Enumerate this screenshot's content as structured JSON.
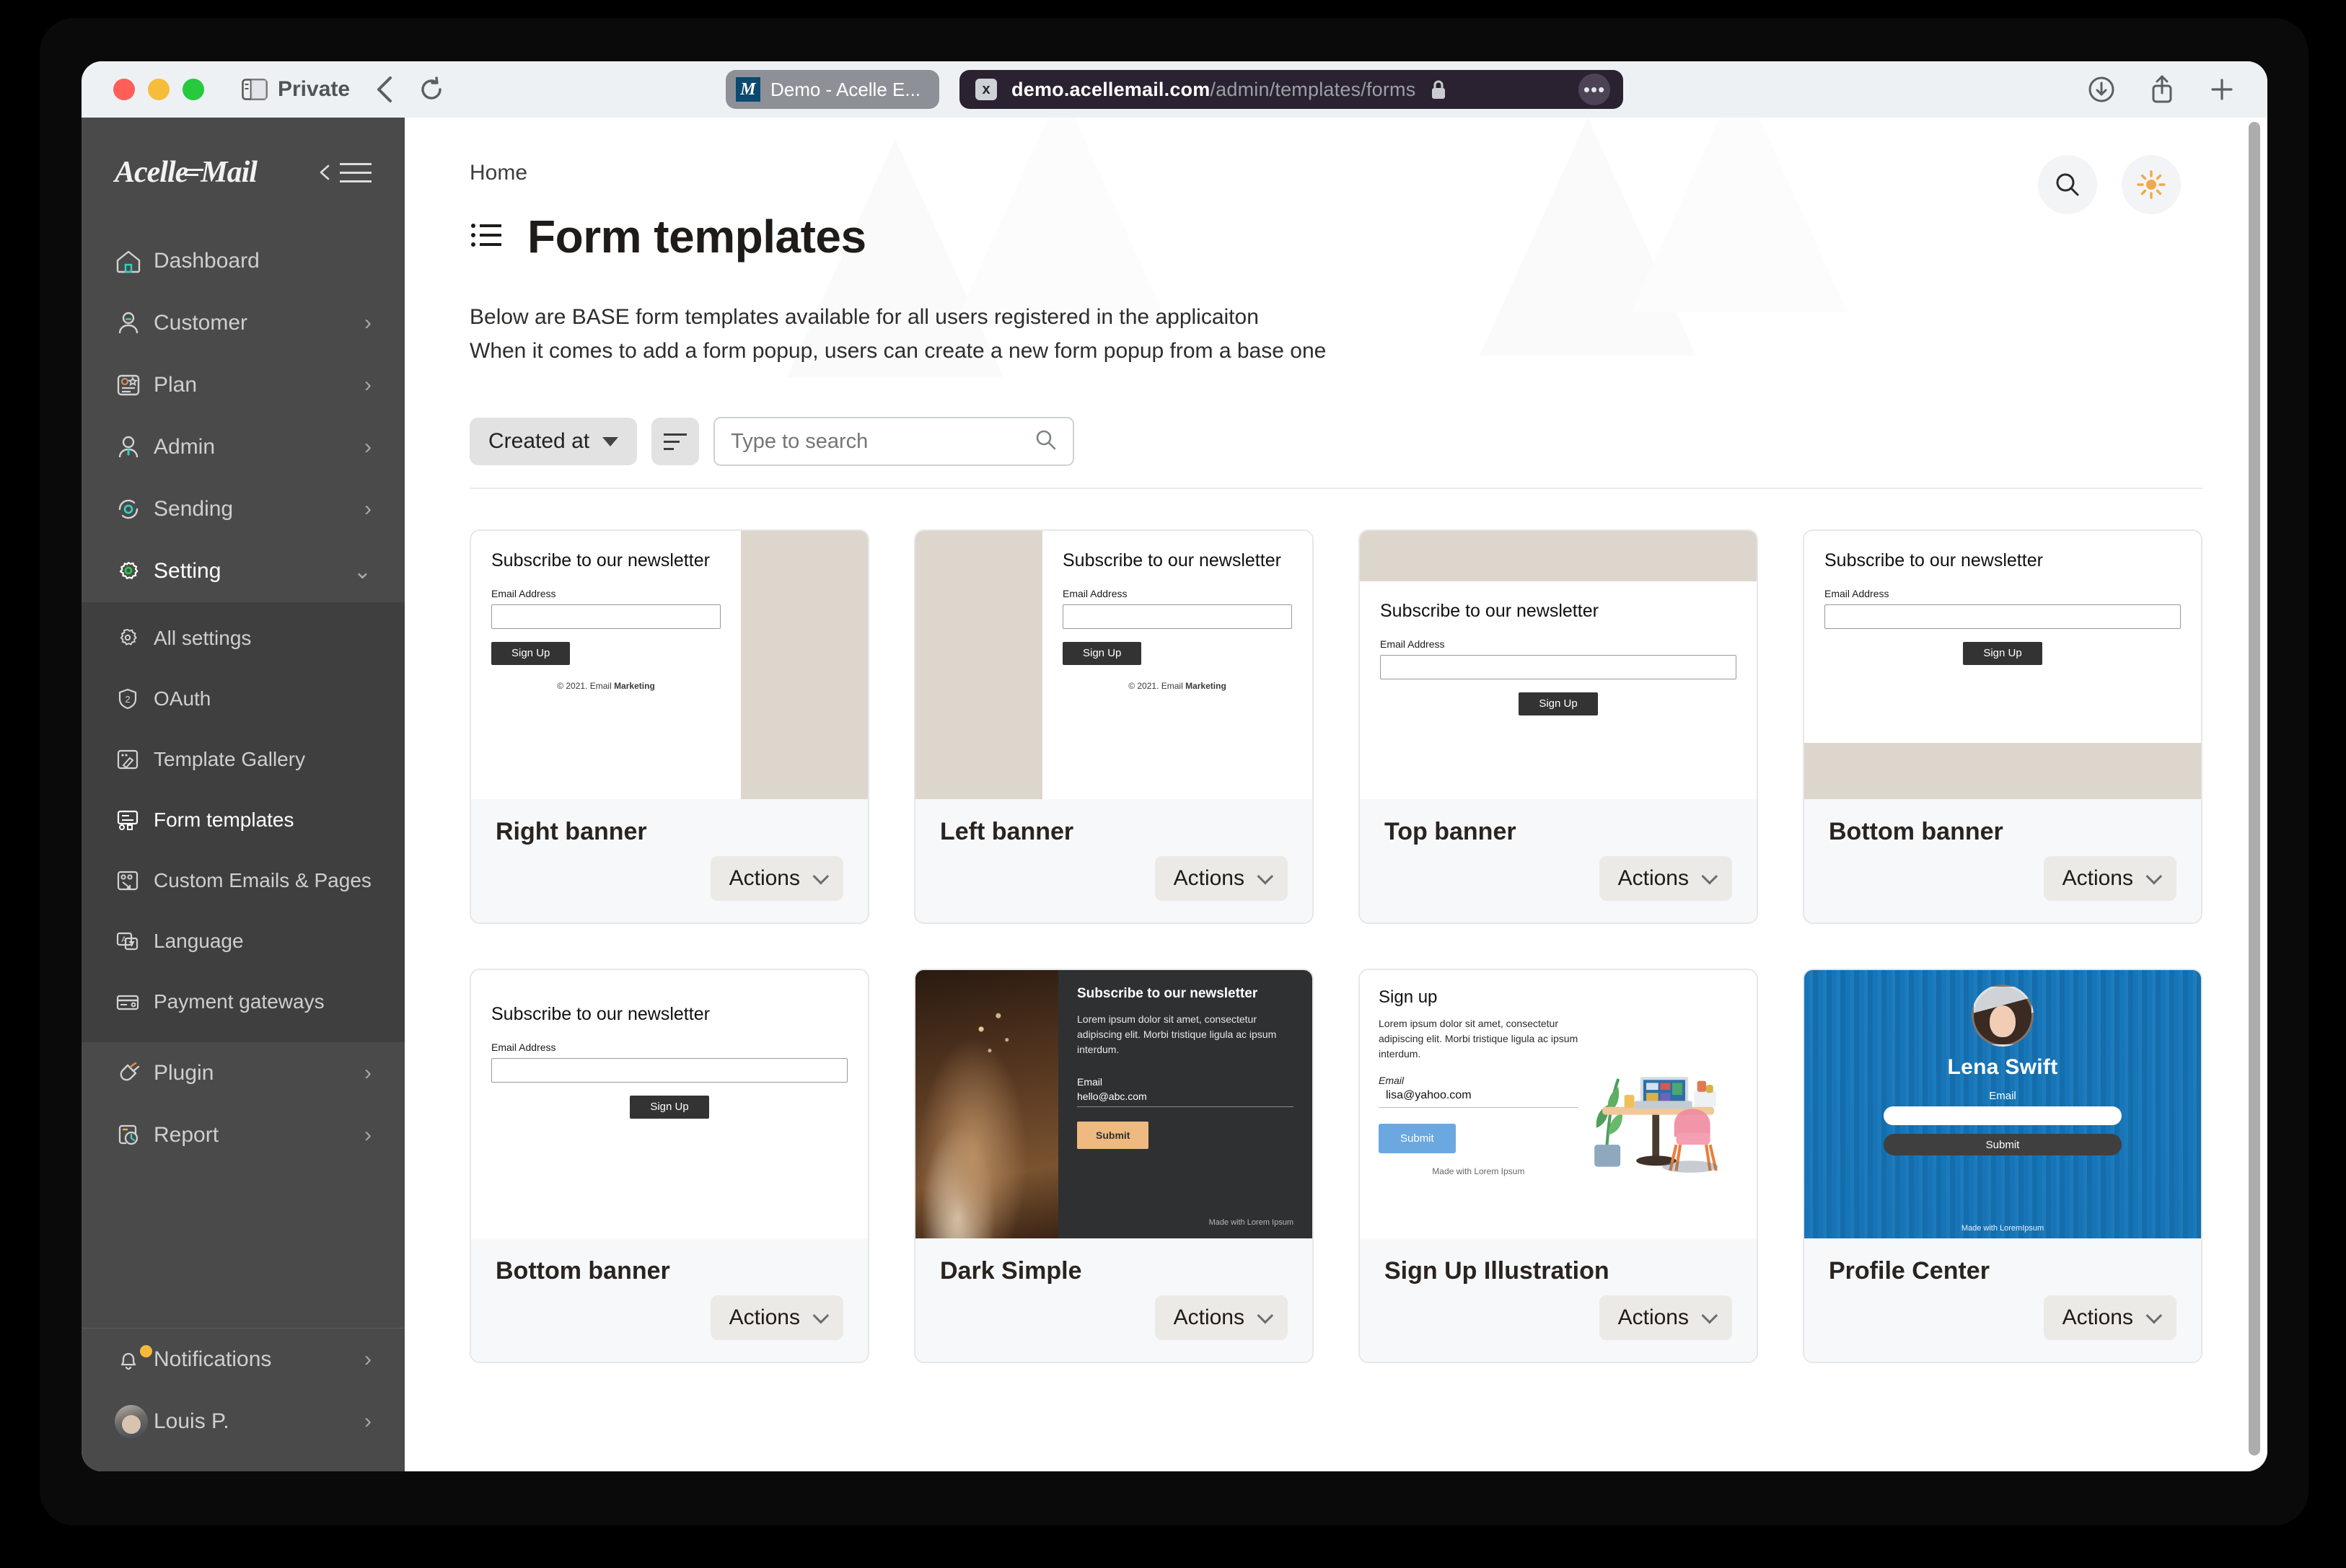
{
  "browser": {
    "private_label": "Private",
    "tab": {
      "favicon_letter": "M",
      "title": "Demo - Acelle E..."
    },
    "url": {
      "domain": "demo.acellemail.com",
      "path": "/admin/templates/forms",
      "close_glyph": "x",
      "menu_glyph": "•••"
    },
    "icons": {
      "sidebar": "sidebar-toggle-icon",
      "back": "back-arrow-icon",
      "reload": "reload-icon",
      "downloads": "downloads-icon",
      "share": "share-icon",
      "newtab": "new-tab-icon",
      "lock": "lock-icon"
    }
  },
  "sidebar": {
    "brand": {
      "left": "Acelle",
      "right": "Mail"
    },
    "items": [
      {
        "label": "Dashboard",
        "icon": "home-icon",
        "chevron": "",
        "active": false
      },
      {
        "label": "Customer",
        "icon": "user-icon",
        "chevron": "›",
        "active": false
      },
      {
        "label": "Plan",
        "icon": "plan-card-icon",
        "chevron": "›",
        "active": false
      },
      {
        "label": "Admin",
        "icon": "admin-user-icon",
        "chevron": "›",
        "active": false
      },
      {
        "label": "Sending",
        "icon": "sending-sync-icon",
        "chevron": "›",
        "active": false
      },
      {
        "label": "Setting",
        "icon": "gear-icon",
        "chevron": "⌄",
        "active": true
      }
    ],
    "submenu": [
      {
        "label": "All settings",
        "icon": "settings-gear-icon",
        "active": false
      },
      {
        "label": "OAuth",
        "icon": "shield-2-icon",
        "active": false
      },
      {
        "label": "Template Gallery",
        "icon": "brush-icon",
        "active": false
      },
      {
        "label": "Form templates",
        "icon": "form-icon",
        "active": true
      },
      {
        "label": "Custom Emails & Pages",
        "icon": "custom-page-icon",
        "active": false
      },
      {
        "label": "Language",
        "icon": "translate-icon",
        "active": false
      },
      {
        "label": "Payment gateways",
        "icon": "credit-card-icon",
        "active": false
      }
    ],
    "items_after": [
      {
        "label": "Plugin",
        "icon": "plug-icon",
        "chevron": "›"
      },
      {
        "label": "Report",
        "icon": "report-clock-icon",
        "chevron": "›"
      }
    ],
    "footer": [
      {
        "label": "Notifications",
        "icon": "bell-icon",
        "chevron": "›",
        "badge": true
      },
      {
        "label": "Louis P.",
        "icon": "avatar",
        "chevron": "›",
        "badge": false
      }
    ]
  },
  "header": {
    "breadcrumb": "Home",
    "title": "Form templates",
    "title_icon": "list-icon",
    "search_icon": "search-icon",
    "theme_icon": "sun-icon",
    "description_line1": "Below are BASE form templates available for all users registered in the applicaiton",
    "description_line2": "When it comes to add a form popup, users can create a new form popup from a base one"
  },
  "toolbar": {
    "sort_field": "Created at",
    "sort_direction_icon": "sort-icon",
    "search_placeholder": "Type to search",
    "search_value": "",
    "search_icon": "search-icon"
  },
  "cards": [
    {
      "name": "Right banner",
      "actions_label": "Actions",
      "layout": "right-banner",
      "title": "Subscribe to our newsletter",
      "field_label": "Email Address",
      "button": "Sign Up",
      "copyright_prefix": "© 2021. Email ",
      "copyright_bold": "Marketing"
    },
    {
      "name": "Left banner",
      "actions_label": "Actions",
      "layout": "left-banner",
      "title": "Subscribe to our newsletter",
      "field_label": "Email Address",
      "button": "Sign Up",
      "copyright_prefix": "© 2021. Email ",
      "copyright_bold": "Marketing"
    },
    {
      "name": "Top banner",
      "actions_label": "Actions",
      "layout": "top-banner",
      "title": "Subscribe to our newsletter",
      "field_label": "Email Address",
      "button": "Sign Up"
    },
    {
      "name": "Bottom banner",
      "actions_label": "Actions",
      "layout": "bottom-banner",
      "title": "Subscribe to our newsletter",
      "field_label": "Email Address",
      "button": "Sign Up"
    },
    {
      "name": "Bottom banner",
      "actions_label": "Actions",
      "layout": "plain",
      "title": "Subscribe to our newsletter",
      "field_label": "Email Address",
      "button": "Sign Up"
    },
    {
      "name": "Dark Simple",
      "actions_label": "Actions",
      "layout": "dark-simple",
      "title": "Subscribe to our newsletter",
      "body": "Lorem ipsum dolor sit amet, consectetur adipiscing elit. Morbi tristique ligula ac ipsum interdum.",
      "field_label": "Email",
      "field_value": "hello@abc.com",
      "button": "Submit",
      "made_with": "Made with  Lorem Ipsum"
    },
    {
      "name": "Sign Up Illustration",
      "actions_label": "Actions",
      "layout": "signup-illustration",
      "title": "Sign up",
      "body": "Lorem ipsum dolor sit amet, consectetur adipiscing elit. Morbi tristique ligula ac ipsum interdum.",
      "field_label": "Email",
      "field_value": "lisa@yahoo.com",
      "button": "Submit",
      "made_with": "Made with  Lorem Ipsum"
    },
    {
      "name": "Profile Center",
      "actions_label": "Actions",
      "layout": "profile-center",
      "person_name": "Lena Swift",
      "field_label": "Email",
      "button": "Submit",
      "made_with": "Made with LoremIpsum"
    }
  ],
  "colors": {
    "sidebar_bg": "#4a4a4a",
    "submenu_bg": "#3f3f3f",
    "beige": "#dcd6cc",
    "accent_orange": "#eeba80",
    "accent_blue": "#6ba8e0",
    "profile_blue": "#1d81c6",
    "theme_sun": "#f0a94b"
  }
}
